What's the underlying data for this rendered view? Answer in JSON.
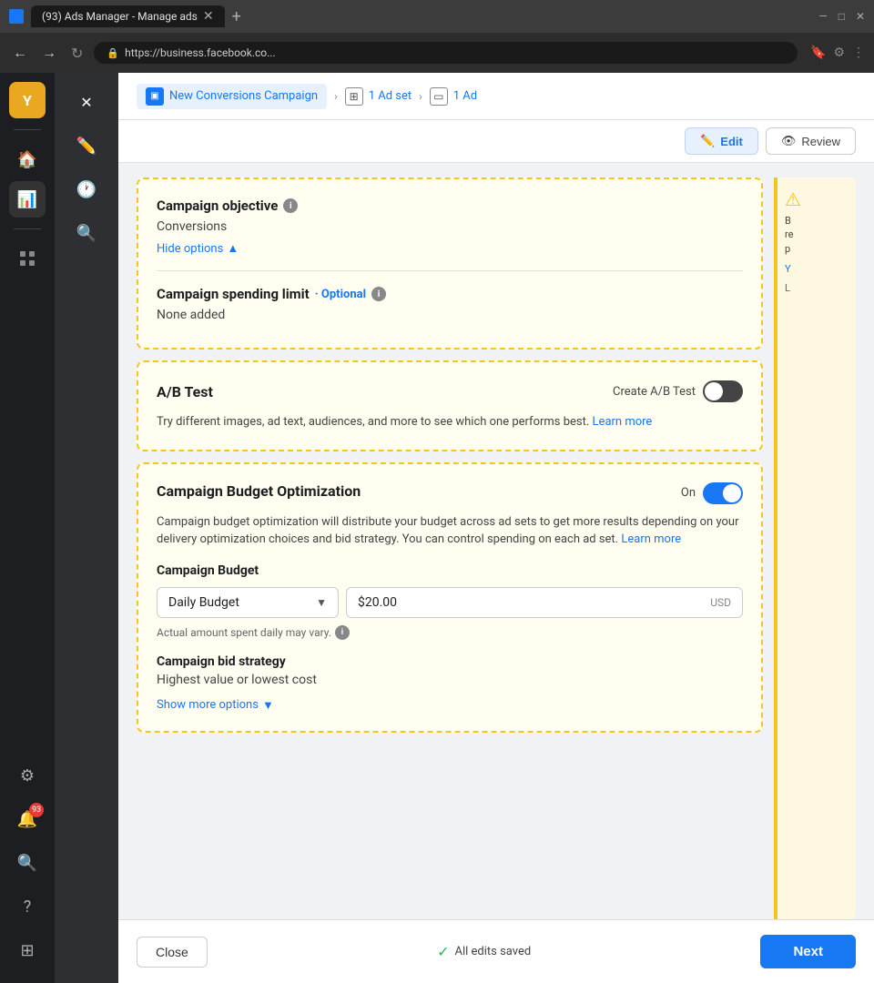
{
  "browser": {
    "tab_count_label": "(93) Ads Manager - Manage ads",
    "url": "https://business.facebook.co...",
    "lock_icon": "🔒"
  },
  "breadcrumb": {
    "campaign_name": "New Conversions Campaign",
    "adset_label": "1 Ad set",
    "ad_label": "1 Ad"
  },
  "action_buttons": {
    "edit_label": "Edit",
    "review_label": "Review"
  },
  "campaign_objective": {
    "section_title": "Campaign objective",
    "info_icon_label": "i",
    "value": "Conversions",
    "hide_options_label": "Hide options"
  },
  "campaign_spending": {
    "section_title": "Campaign spending limit",
    "optional_label": "· Optional",
    "value": "None added"
  },
  "ab_test": {
    "title": "A/B Test",
    "toggle_label": "Create A/B Test",
    "toggle_on": false,
    "description": "Try different images, ad text, audiences, and more to see which one performs best.",
    "learn_more_label": "Learn more"
  },
  "cbo": {
    "title": "Campaign Budget Optimization",
    "toggle_on": true,
    "on_label": "On",
    "description": "Campaign budget optimization will distribute your budget across ad sets to get more results depending on your delivery optimization choices and bid strategy. You can control spending on each ad set.",
    "learn_more_label": "Learn more",
    "budget_label": "Campaign Budget",
    "budget_type": "Daily Budget",
    "budget_amount": "$20.00",
    "usd_label": "USD",
    "actual_amount_note": "Actual amount spent daily may vary.",
    "bid_strategy_label": "Campaign bid strategy",
    "bid_strategy_value": "Highest value or lowest cost",
    "show_more_label": "Show more options"
  },
  "footer": {
    "close_label": "Close",
    "saved_label": "All edits saved",
    "next_label": "Next"
  },
  "sidebar": {
    "items": [
      {
        "icon": "🏠",
        "label": "Home"
      },
      {
        "icon": "📊",
        "label": "Analytics"
      },
      {
        "icon": "✏️",
        "label": "Edit"
      },
      {
        "icon": "🕐",
        "label": "History"
      },
      {
        "icon": "🔍",
        "label": "Search"
      },
      {
        "icon": "⊞",
        "label": "Grid"
      }
    ]
  },
  "colors": {
    "accent_blue": "#1877f2",
    "warning_yellow": "#f5c518",
    "toggle_off": "#444444",
    "toggle_on": "#1877f2",
    "green_check": "#1db954"
  }
}
